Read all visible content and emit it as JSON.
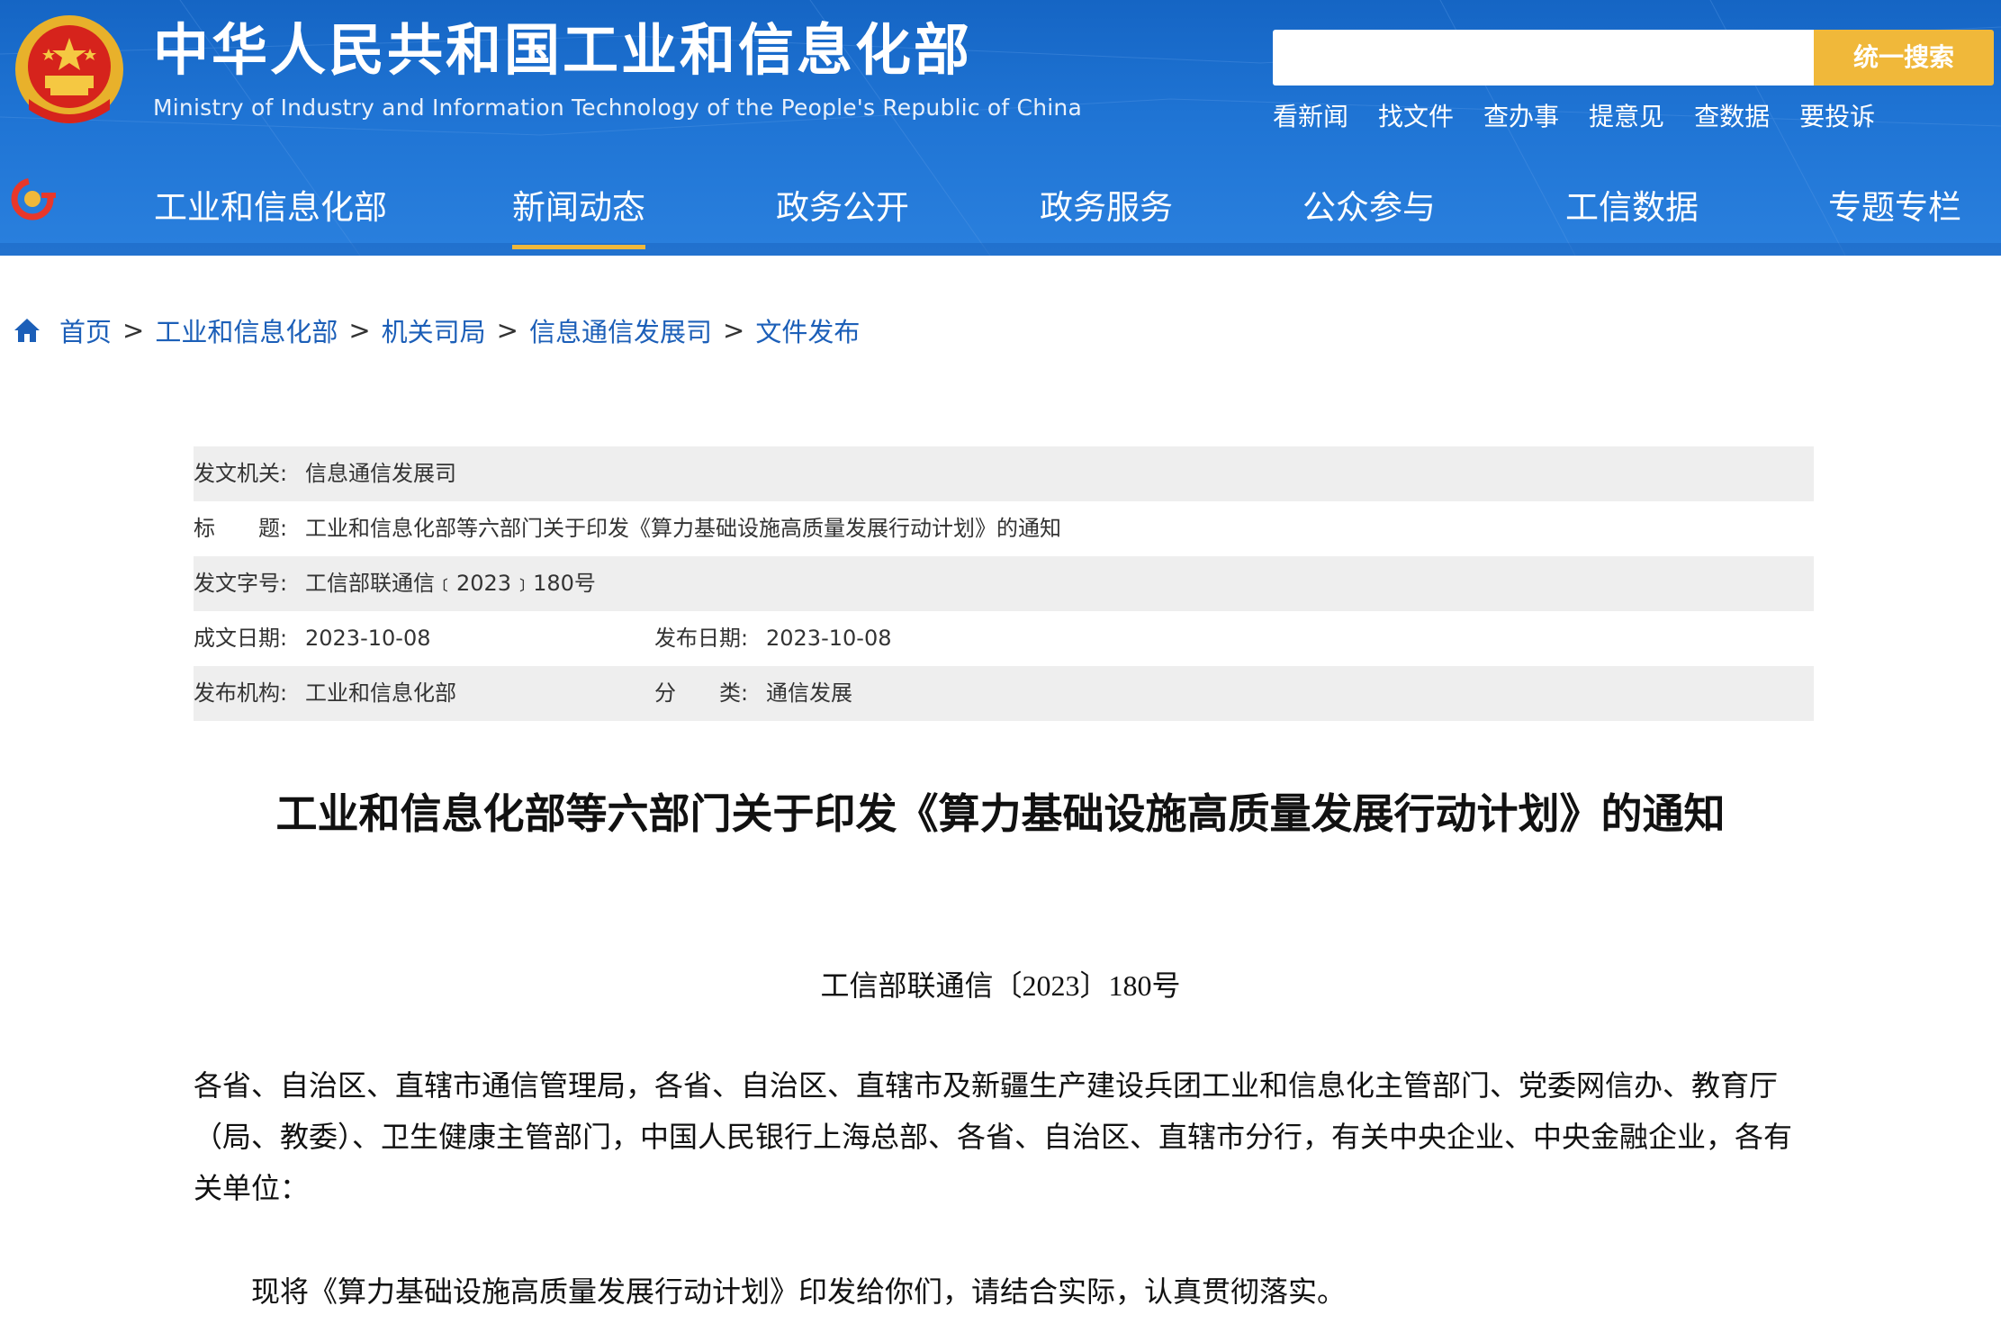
{
  "header": {
    "title": "中华人民共和国工业和信息化部",
    "subtitle": "Ministry of Industry and Information Technology of the People's Republic of China",
    "search": {
      "placeholder": "",
      "button_label": "统一搜索"
    },
    "quick_links": [
      "看新闻",
      "找文件",
      "查办事",
      "提意见",
      "查数据",
      "要投诉"
    ],
    "emblem_icon": "national-emblem-icon",
    "brand_color": "#1f74d4",
    "accent_color": "#f0b83a"
  },
  "nav": {
    "items": [
      "工业和信息化部",
      "新闻动态",
      "政务公开",
      "政务服务",
      "公众参与",
      "工信数据",
      "专题专栏"
    ],
    "active": "新闻动态"
  },
  "breadcrumb": {
    "items": [
      "首页",
      "工业和信息化部",
      "机关司局",
      "信息通信发展司",
      "文件发布"
    ],
    "separator": ">"
  },
  "meta": {
    "issuer_label": "发文机关:",
    "issuer": "信息通信发展司",
    "title_label": "标　　题:",
    "title": "工业和信息化部等六部门关于印发《算力基础设施高质量发展行动计划》的通知",
    "docno_label": "发文字号:",
    "docno": "工信部联通信﹝2023﹞180号",
    "created_label": "成文日期:",
    "created": "2023-10-08",
    "published_label": "发布日期:",
    "published": "2023-10-08",
    "org_label": "发布机构:",
    "org": "工业和信息化部",
    "category_label": "分　　类:",
    "category": "通信发展"
  },
  "article": {
    "title": "工业和信息化部等六部门关于印发《算力基础设施高质量发展行动计划》的通知",
    "doc_number": "工信部联通信〔2023〕180号",
    "body_para1": "各省、自治区、直辖市通信管理局，各省、自治区、直辖市及新疆生产建设兵团工业和信息化主管部门、党委网信办、教育厅（局、教委）、卫生健康主管部门，中国人民银行上海总部、各省、自治区、直辖市分行，有关中央企业、中央金融企业，各有关单位：",
    "body_para2": "现将《算力基础设施高质量发展行动计划》印发给你们，请结合实际，认真贯彻落实。"
  }
}
